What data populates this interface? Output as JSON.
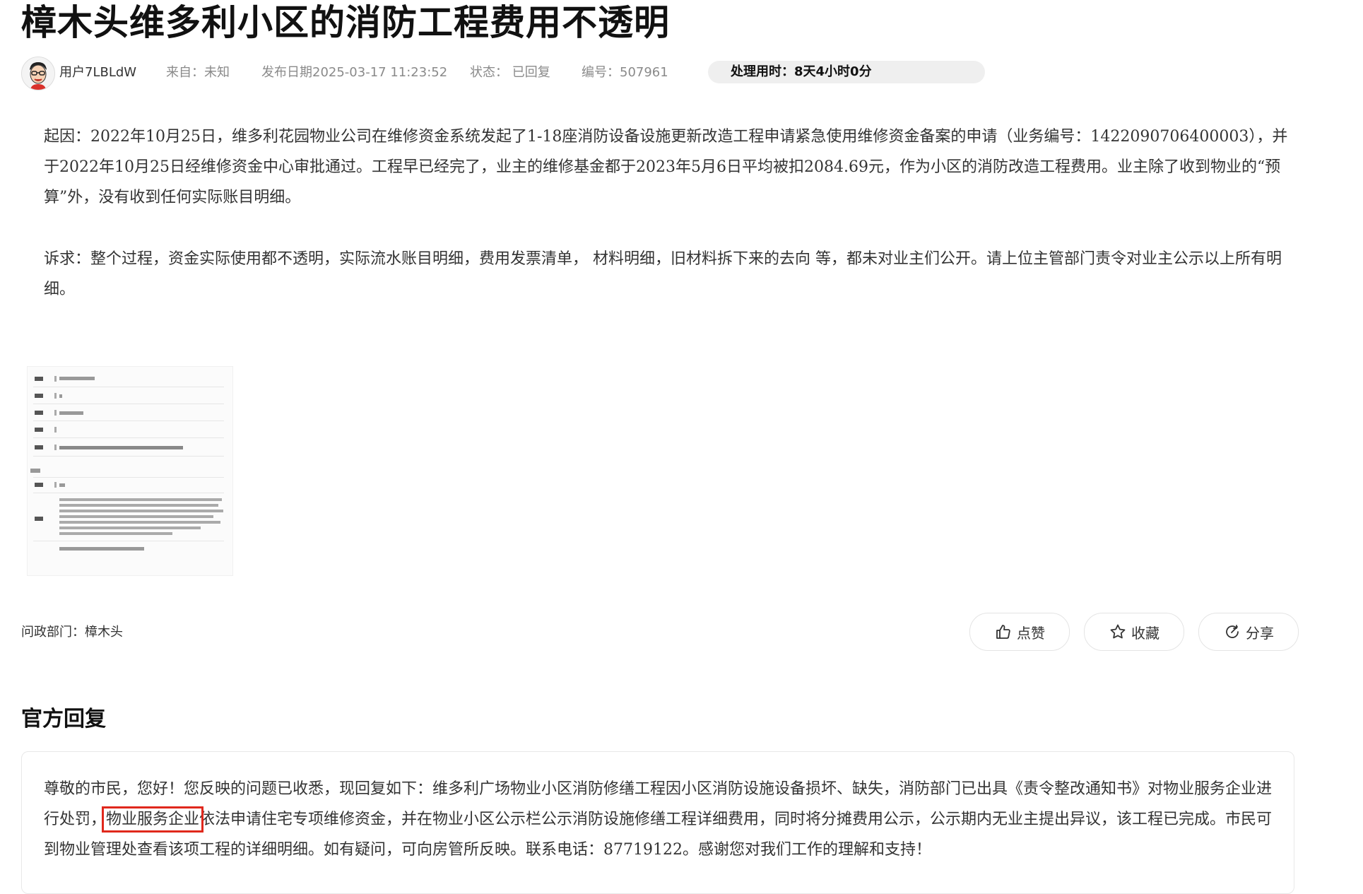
{
  "post": {
    "title": "樟木头维多利小区的消防工程费用不透明",
    "user": "用户7LBLdW",
    "from": "来自：未知",
    "date": "发布日期2025-03-17 11:23:52",
    "status": "状态：  已回复",
    "id": "编号：507961",
    "processing_time": "处理用时：8天4小时0分",
    "paragraph_1": "起因：2022年10月25日，维多利花园物业公司在维修资金系统发起了1-18座消防设备设施更新改造工程申请紧急使用维修资金备案的申请（业务编号：1422090706400003），并于2022年10月25日经维修资金中心审批通过。工程早已经完了，业主的维修基金都于2023年5月6日平均被扣2084.69元，作为小区的消防改造工程费用。业主除了收到物业的“预算”外，没有收到任何实际账目明细。",
    "paragraph_2": "诉求：整个过程，资金实际使用都不透明，实际流水账目明细，费用发票清单，  材料明细，旧材料拆下来的去向 等，都未对业主们公开。请上位主管部门责令对业主公示以上所有明细。",
    "department_label": "问政部门：",
    "department": "樟木头"
  },
  "actions": {
    "like": "点赞",
    "favorite": "收藏",
    "share": "分享"
  },
  "reply": {
    "heading": "官方回复",
    "text_before": "尊敬的市民，您好！您反映的问题已收悉，现回复如下：维多利广场物业小区消防修缮工程因小区消防设施设备损坏、缺失，消防部门已出具《责令整改通知书》对物业服务企业进行处罚，",
    "text_highlight": "物业服务企业",
    "text_after": "依法申请住宅专项维修资金，并在物业小区公示栏公示消防设施修缮工程详细费用，同时将分摊费用公示，公示期内无业主提出异议，该工程已完成。市民可到物业管理处查看该项工程的详细明细。如有疑问，可向房管所反映。联系电话：87719122。感谢您对我们工作的理解和支持！"
  },
  "colors": {
    "highlight_border": "#e0281c",
    "pill_bg": "#efefef"
  }
}
